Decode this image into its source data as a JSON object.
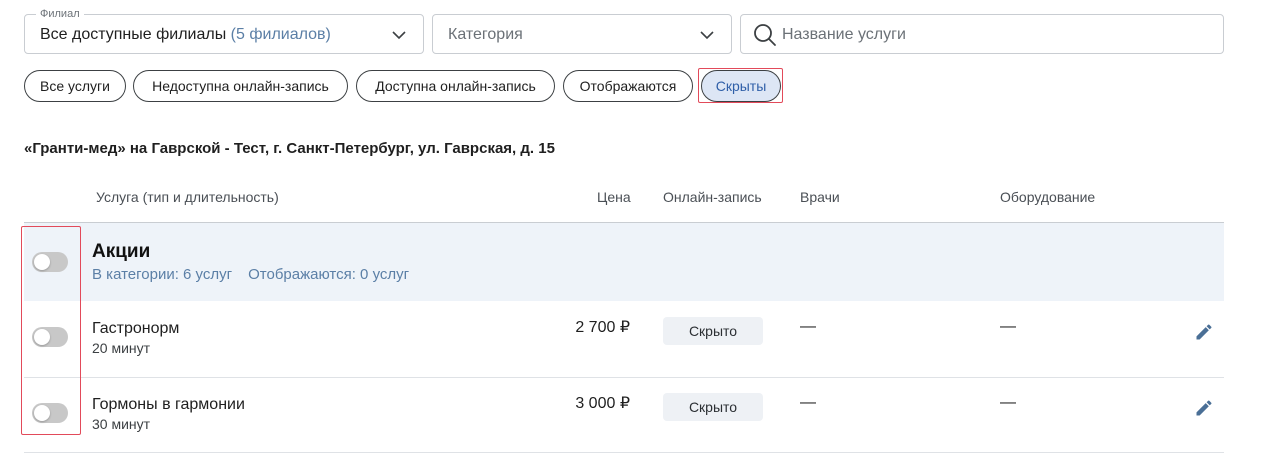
{
  "filters": {
    "branch": {
      "legend": "Филиал",
      "value": "Все доступные филиалы",
      "count": "(5 филиалов)"
    },
    "category": {
      "placeholder": "Категория"
    },
    "search": {
      "placeholder": "Название услуги"
    }
  },
  "chips": [
    {
      "label": "Все услуги",
      "selected": false
    },
    {
      "label": "Недоступна онлайн-запись",
      "selected": false
    },
    {
      "label": "Доступна онлайн-запись",
      "selected": false
    },
    {
      "label": "Отображаются",
      "selected": false
    },
    {
      "label": "Скрыты",
      "selected": true
    }
  ],
  "branch_title": "«Гранти-мед» на Гаврской - Тест, г. Санкт-Петербург, ул. Гаврская, д. 15",
  "table": {
    "headers": {
      "service": "Услуга (тип и длительность)",
      "price": "Цена",
      "online": "Онлайн-запись",
      "doctors": "Врачи",
      "equipment": "Оборудование"
    },
    "category": {
      "title": "Акции",
      "in_category": "В категории: 6 услуг",
      "shown": "Отображаются: 0 услуг",
      "toggle_on": false
    },
    "rows": [
      {
        "name": "Гастронорм",
        "duration": "20 минут",
        "price": "2 700 ₽",
        "status": "Скрыто",
        "doctors": "—",
        "equipment": "—",
        "toggle_on": false
      },
      {
        "name": "Гормоны в гармонии",
        "duration": "30 минут",
        "price": "3 000 ₽",
        "status": "Скрыто",
        "doctors": "—",
        "equipment": "—",
        "toggle_on": false
      }
    ]
  },
  "colors": {
    "accent": "#2f5fa8",
    "highlight": "#e24a5a",
    "category_bg": "#eef3f9"
  }
}
